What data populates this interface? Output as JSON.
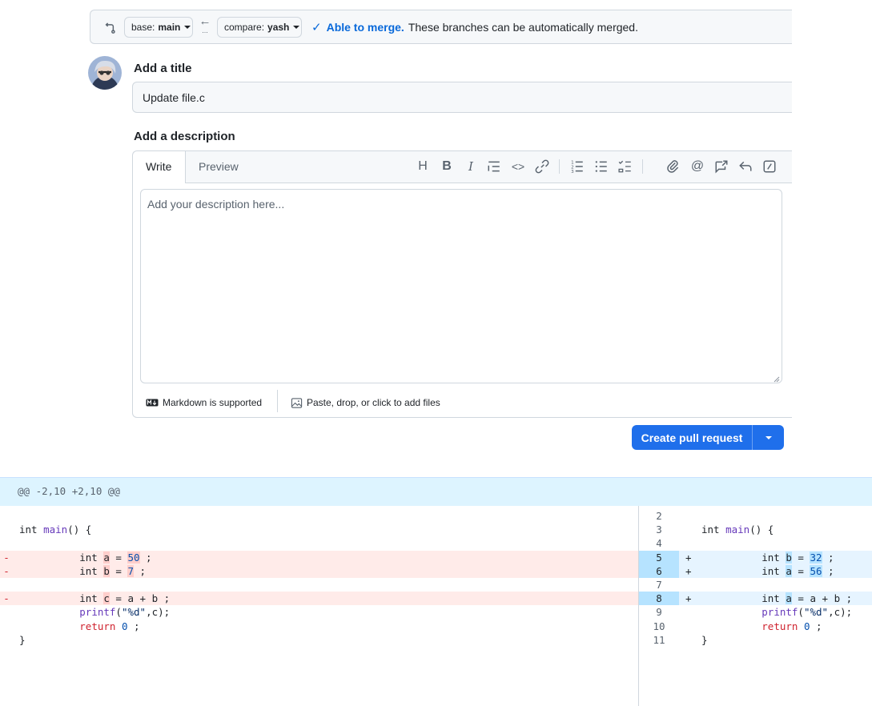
{
  "compare_bar": {
    "base_prefix": "base:",
    "base_branch": "main",
    "compare_prefix": "compare:",
    "compare_branch": "yash",
    "merge_status_strong": "Able to merge.",
    "merge_status_text": "These branches can be automatically merged."
  },
  "title": {
    "label": "Add a title",
    "value": "Update file.c"
  },
  "description": {
    "label": "Add a description",
    "tabs": [
      "Write",
      "Preview"
    ],
    "placeholder": "Add your description here...",
    "toolbar_icons": [
      "heading-icon",
      "bold-icon",
      "italic-icon",
      "quote-icon",
      "code-icon",
      "link-icon",
      "numbered-list-icon",
      "bulleted-list-icon",
      "task-list-icon",
      "attach-icon",
      "mention-icon",
      "reference-icon",
      "undo-icon",
      "slash-command-icon"
    ],
    "footer_markdown": "Markdown is supported",
    "footer_attach": "Paste, drop, or click to add files"
  },
  "create_pr": {
    "label": "Create pull request"
  },
  "diff": {
    "hunk_header": "@@ -2,10 +2,10 @@",
    "colors": {
      "deletion_bg": "#ffebe9",
      "addition_bg": "#e6f4ff",
      "hunk_bg": "#ddf4ff"
    },
    "left_lines": [
      {
        "type": "blank",
        "text": ""
      },
      {
        "type": "context",
        "text": "int main() {"
      },
      {
        "type": "blank",
        "text": ""
      },
      {
        "type": "del",
        "marker": "-",
        "text": "int a = 50 ;"
      },
      {
        "type": "del",
        "marker": "-",
        "text": "int b = 7 ;"
      },
      {
        "type": "blank",
        "text": ""
      },
      {
        "type": "del",
        "marker": "-",
        "text": "int c = a + b ;"
      },
      {
        "type": "context",
        "text": "printf(\"%d\",c);"
      },
      {
        "type": "context",
        "text": "return 0 ;"
      },
      {
        "type": "context",
        "text": "}"
      }
    ],
    "right_lines": [
      {
        "num": "2",
        "type": "context",
        "text": ""
      },
      {
        "num": "3",
        "type": "context",
        "text": "int main() {"
      },
      {
        "num": "4",
        "type": "context",
        "text": ""
      },
      {
        "num": "5",
        "type": "add",
        "marker": "+",
        "text": "int b = 32 ;"
      },
      {
        "num": "6",
        "type": "add",
        "marker": "+",
        "text": "int a = 56 ;"
      },
      {
        "num": "7",
        "type": "context",
        "text": ""
      },
      {
        "num": "8",
        "type": "add",
        "marker": "+",
        "text": "int a = a + b ;"
      },
      {
        "num": "9",
        "type": "context",
        "text": "printf(\"%d\",c);"
      },
      {
        "num": "10",
        "type": "context",
        "text": "return 0 ;"
      },
      {
        "num": "11",
        "type": "context",
        "text": "}"
      }
    ]
  }
}
